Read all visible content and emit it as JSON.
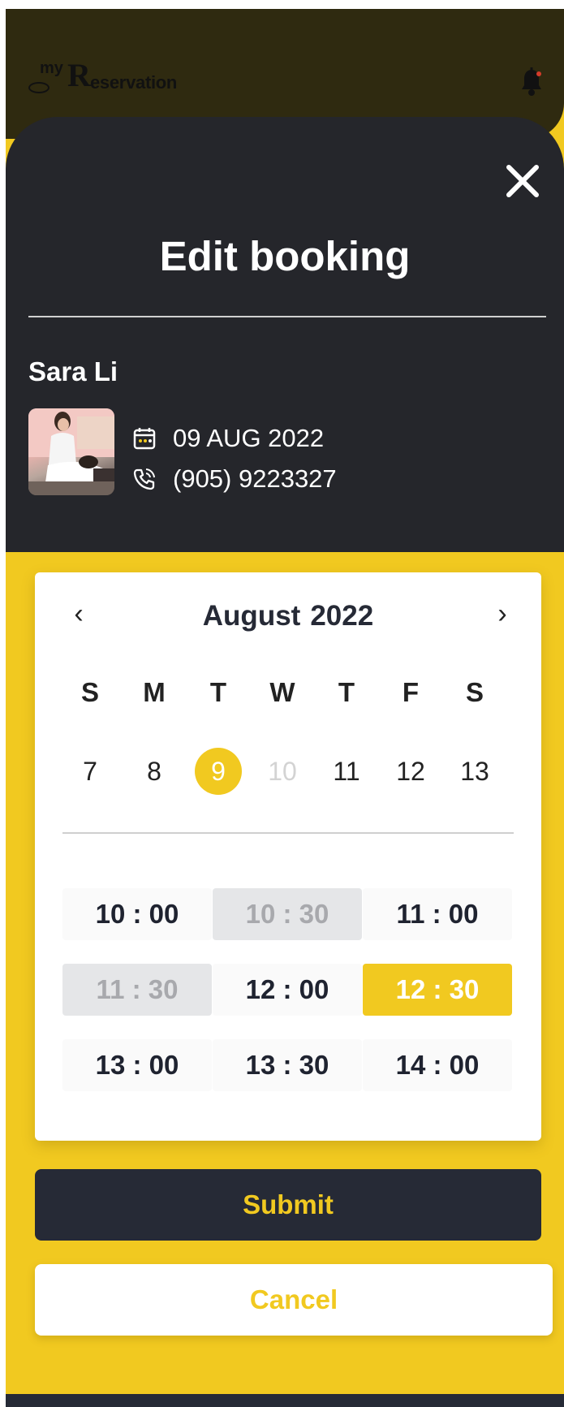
{
  "app": {
    "logo_prefix": "my",
    "logo_initial": "R",
    "logo_suffix": "eservation"
  },
  "modal": {
    "title": "Edit booking",
    "close_icon": "close-icon"
  },
  "booking": {
    "customer_name": "Sara Li",
    "date": "09 AUG 2022",
    "phone": "(905) 9223327"
  },
  "calendar": {
    "prev_label": "‹",
    "next_label": "›",
    "month": "August",
    "year": "2022",
    "weekdays": [
      "S",
      "M",
      "T",
      "W",
      "T",
      "F",
      "S"
    ],
    "days": [
      {
        "label": "7",
        "state": "normal"
      },
      {
        "label": "8",
        "state": "normal"
      },
      {
        "label": "9",
        "state": "selected"
      },
      {
        "label": "10",
        "state": "disabled"
      },
      {
        "label": "11",
        "state": "normal"
      },
      {
        "label": "12",
        "state": "normal"
      },
      {
        "label": "13",
        "state": "normal"
      }
    ]
  },
  "time_slots": [
    {
      "label": "10 : 00",
      "state": "available"
    },
    {
      "label": "10 : 30",
      "state": "disabled"
    },
    {
      "label": "11 : 00",
      "state": "available"
    },
    {
      "label": "11 : 30",
      "state": "disabled"
    },
    {
      "label": "12 : 00",
      "state": "available"
    },
    {
      "label": "12 : 30",
      "state": "selected"
    },
    {
      "label": "13 : 00",
      "state": "available"
    },
    {
      "label": "13 : 30",
      "state": "available"
    },
    {
      "label": "14 : 00",
      "state": "available"
    }
  ],
  "actions": {
    "submit_label": "Submit",
    "cancel_label": "Cancel"
  },
  "colors": {
    "accent": "#f1c920",
    "dark": "#262a36",
    "sheet": "#25262b"
  }
}
